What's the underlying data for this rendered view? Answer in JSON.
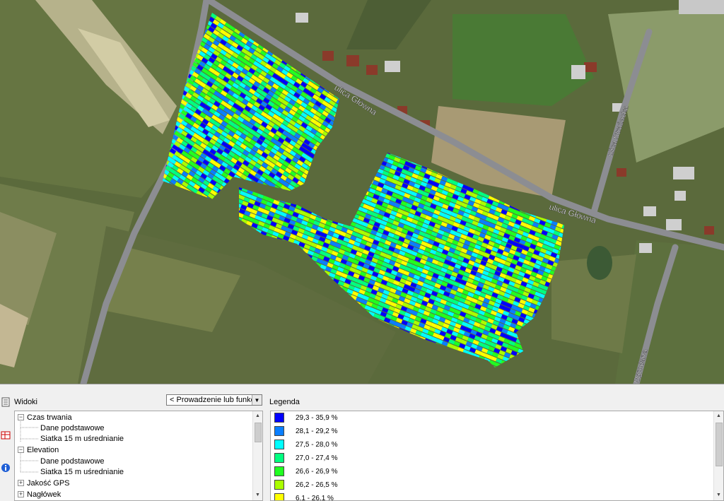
{
  "map": {
    "roads": [
      {
        "label": "ulica Główna"
      },
      {
        "label": "ulica Główna"
      },
      {
        "label": "ulica Strażacka"
      },
      {
        "label": "Ogrodana"
      }
    ],
    "colors": {
      "ground": "#5b6a3c",
      "road": "#8c8d92",
      "field_light": "#c8c39a"
    }
  },
  "bottom_panel": {
    "views_label": "Widoki",
    "view_select": "< Prowadzenie lub funkcje >",
    "tree": [
      {
        "label": "Czas trwania",
        "level": 0,
        "expander": "−"
      },
      {
        "label": "Dane podstawowe",
        "level": 1
      },
      {
        "label": "Siatka 15 m uśrednianie",
        "level": 1
      },
      {
        "label": "Elevation",
        "level": 0,
        "expander": "−"
      },
      {
        "label": "Dane podstawowe",
        "level": 1
      },
      {
        "label": "Siatka 15 m uśrednianie",
        "level": 1
      },
      {
        "label": "Jakość GPS",
        "level": 0,
        "expander": "+"
      },
      {
        "label": "Nagłówek",
        "level": 0,
        "expander": "+"
      }
    ],
    "legend_label": "Legenda",
    "legend": [
      {
        "range": "29,3 - 35,9 %",
        "color": "#0000ff"
      },
      {
        "range": "28,1 - 29,2 %",
        "color": "#0a7fff"
      },
      {
        "range": "27,5 - 28,0 %",
        "color": "#00ffff"
      },
      {
        "range": "27,0 - 27,4 %",
        "color": "#00ff80"
      },
      {
        "range": "26,6 - 26,9 %",
        "color": "#21ff21"
      },
      {
        "range": "26,2 - 26,5 %",
        "color": "#aaff00"
      },
      {
        "range": "6,1 - 26,1 %",
        "color": "#ffff00"
      }
    ]
  }
}
